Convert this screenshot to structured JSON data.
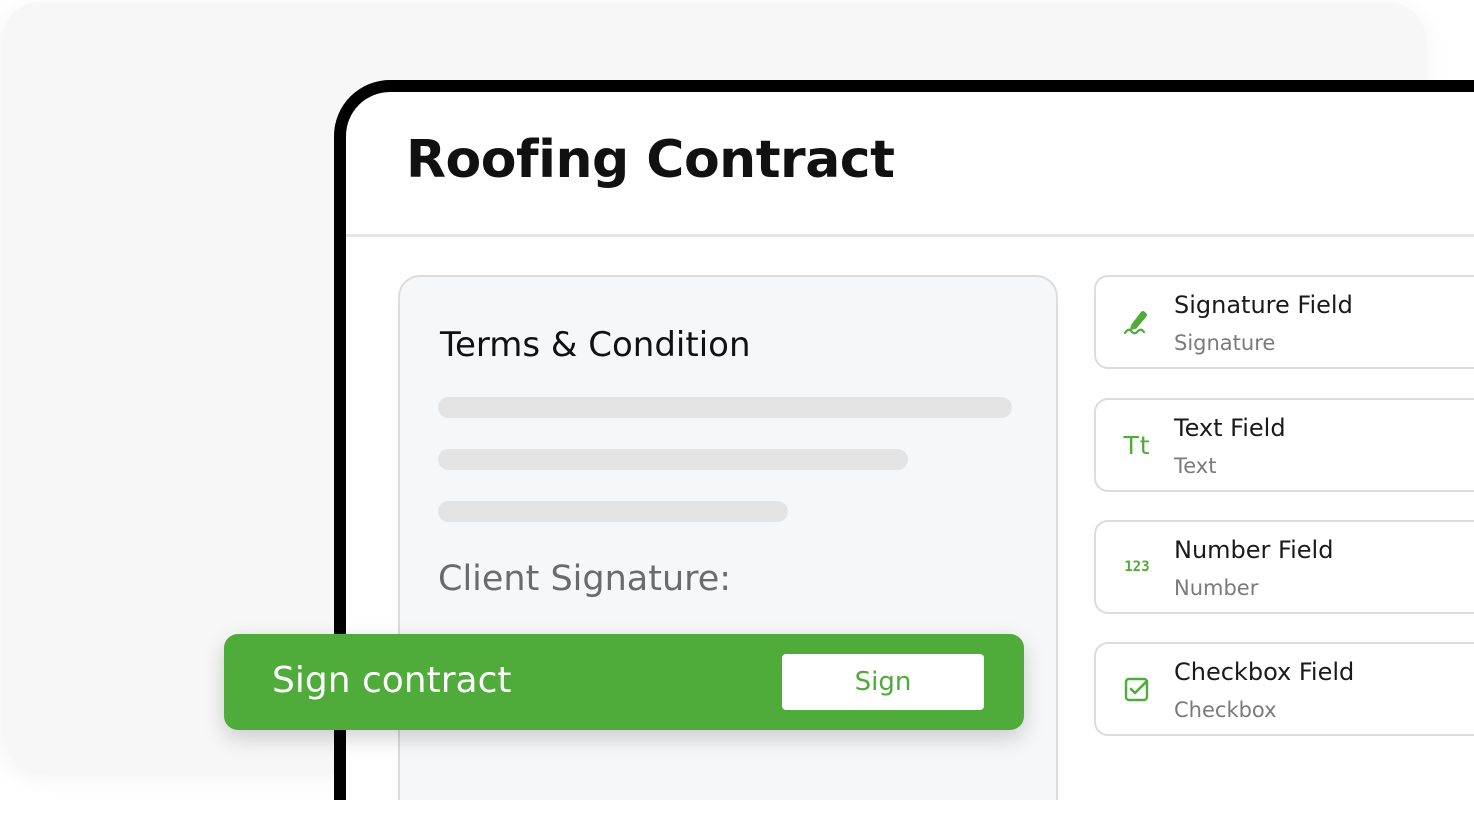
{
  "document": {
    "title": "Roofing Contract"
  },
  "terms": {
    "title": "Terms & Condition",
    "client_signature_label": "Client Signature:"
  },
  "fields": [
    {
      "title": "Signature Field",
      "subtitle": "Signature",
      "icon": "signature-pen-icon"
    },
    {
      "title": "Text Field",
      "subtitle": "Text",
      "icon": "text-tt-icon",
      "glyph": "Tt"
    },
    {
      "title": "Number Field",
      "subtitle": "Number",
      "icon": "number-123-icon",
      "glyph": "123"
    },
    {
      "title": "Checkbox Field",
      "subtitle": "Checkbox",
      "icon": "checkbox-icon"
    }
  ],
  "sign_banner": {
    "label": "Sign contract",
    "button_label": "Sign"
  },
  "colors": {
    "accent": "#4fab3a",
    "frame": "#000000",
    "backdrop": "#f7f7f8",
    "card_bg": "#f6f7f9"
  }
}
